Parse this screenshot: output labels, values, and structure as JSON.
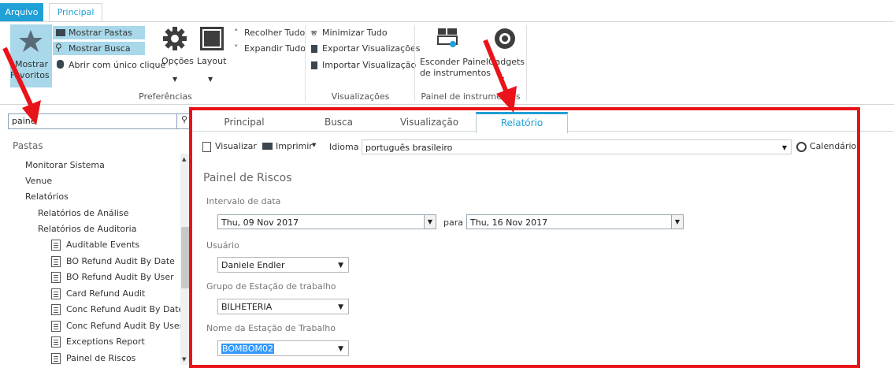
{
  "ribbon": {
    "tabs": [
      "Arquivo",
      "Principal"
    ],
    "mostrar_favoritos": [
      "Mostrar",
      "Favoritos"
    ],
    "mostrar_pastas": "Mostrar Pastas",
    "mostrar_busca": "Mostrar Busca",
    "abrir_clique": "Abrir com único clique",
    "opcoes": "Opções",
    "layout": "Layout",
    "recolher": "Recolher Tudo",
    "expandir": "Expandir Tudo",
    "group_preferencias": "Preferências",
    "minimizar": "Minimizar Tudo",
    "exportar": "Exportar Visualizações",
    "importar": "Importar Visualização",
    "group_visualizacoes": "Visualizações",
    "esconder_painel": [
      "Esconder Painel",
      "de instrumentos"
    ],
    "gadgets": "Gadgets",
    "group_painel": "Painel de instrumentos"
  },
  "sidebar": {
    "search_value": "paine",
    "pastas": "Pastas",
    "items": [
      "Monitorar Sistema",
      "Venue",
      "Relatórios",
      "Relatórios de Análise",
      "Relatórios de Auditoria",
      "Auditable Events",
      "BO Refund Audit By Date",
      "BO Refund Audit By User",
      "Card Refund Audit",
      "Conc Refund Audit By Date/",
      "Conc Refund Audit By User",
      "Exceptions Report",
      "Painel de Riscos"
    ]
  },
  "main": {
    "tabs": [
      "Principal",
      "Busca",
      "Visualização",
      "Relatório"
    ],
    "toolbar": {
      "visualizar": "Visualizar",
      "imprimir": "Imprimir",
      "idioma_label": "Idioma",
      "idioma_value": "português brasileiro",
      "calendario": "Calendário"
    },
    "report_title": "Painel de Riscos",
    "intervalo_label": "Intervalo de data",
    "date_from": "Thu, 09 Nov 2017",
    "para": "para",
    "date_to": "Thu, 16 Nov 2017",
    "usuario_label": "Usuário",
    "usuario_value": "Daniele Endler",
    "grupo_label": "Grupo de Estação de trabalho",
    "grupo_value": "BILHETERIA",
    "nome_label": "Nome da Estação de Trabalho",
    "nome_value": "BOMBOM02"
  },
  "colors": {
    "accent": "#1fa0d6",
    "highlight": "#a8d8ea",
    "annotation_red": "#e8141a"
  }
}
